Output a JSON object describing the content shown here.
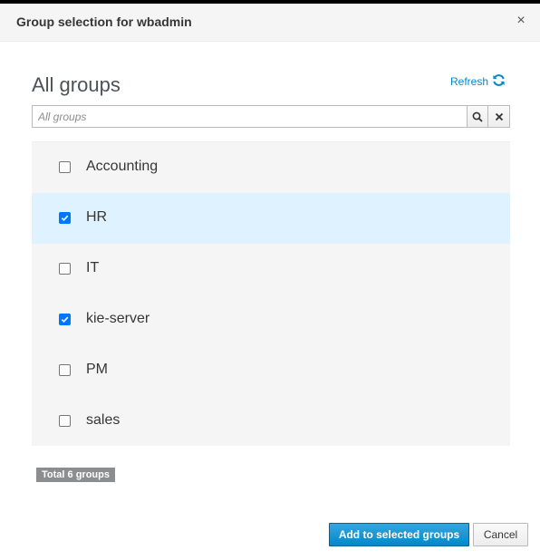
{
  "dialog": {
    "title": "Group selection for wbadmin",
    "close_glyph": "×"
  },
  "section": {
    "title": "All groups",
    "refresh_label": "Refresh"
  },
  "search": {
    "placeholder": "All groups",
    "value": ""
  },
  "groups": [
    {
      "label": "Accounting",
      "checked": false,
      "selected": false
    },
    {
      "label": "HR",
      "checked": true,
      "selected": true
    },
    {
      "label": "IT",
      "checked": false,
      "selected": false
    },
    {
      "label": "kie-server",
      "checked": true,
      "selected": false
    },
    {
      "label": "PM",
      "checked": false,
      "selected": false
    },
    {
      "label": "sales",
      "checked": false,
      "selected": false
    }
  ],
  "total_label": "Total 6 groups",
  "footer": {
    "add_label": "Add to selected groups",
    "cancel_label": "Cancel"
  },
  "colors": {
    "accent": "#0088ce",
    "selected_row": "#def3ff",
    "checkbox_checked": "#0075ff",
    "badge": "#8b8d8f"
  },
  "icons": {
    "refresh": "refresh-icon",
    "search": "search-icon",
    "clear": "clear-icon",
    "close": "close-icon"
  }
}
